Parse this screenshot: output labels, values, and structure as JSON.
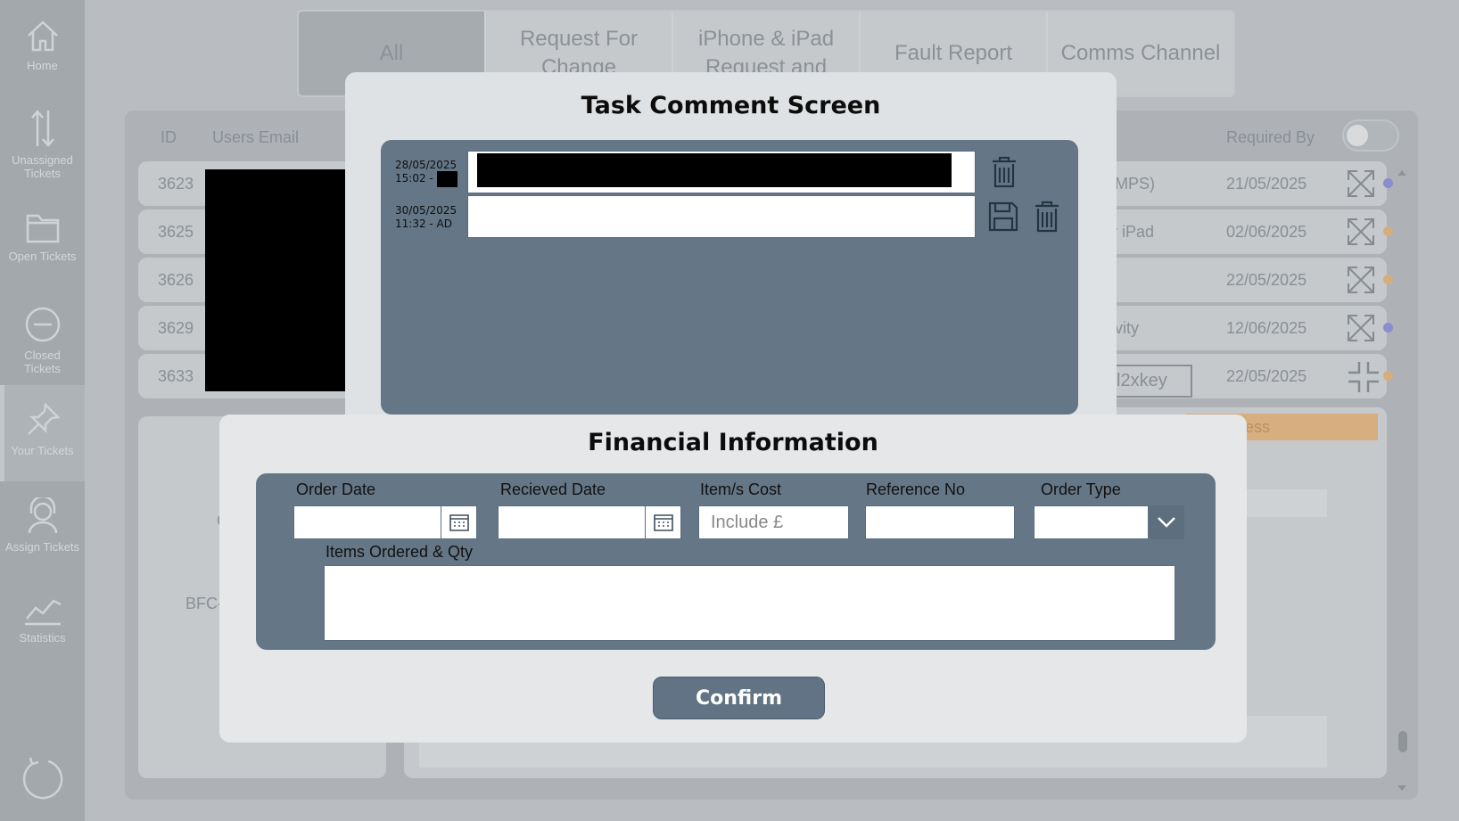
{
  "sidebar": {
    "items": [
      {
        "label": "Home",
        "icon": "home-icon"
      },
      {
        "label": "Unassigned Tickets",
        "icon": "sort-arrows-icon"
      },
      {
        "label": "Open Tickets",
        "icon": "folder-icon"
      },
      {
        "label": "Closed Tickets",
        "icon": "minus-circle-icon"
      },
      {
        "label": "Your Tickets",
        "icon": "pin-icon"
      },
      {
        "label": "Assign Tickets",
        "icon": "headset-icon"
      },
      {
        "label": "Statistics",
        "icon": "chart-line-icon"
      }
    ],
    "active_index": 4
  },
  "tabs": [
    "All",
    "Request For Change",
    "iPhone & iPad Request and",
    "Fault Report",
    "Comms Channel"
  ],
  "table": {
    "headers": {
      "id": "ID",
      "email": "Users Email",
      "required_by": "Required By"
    },
    "rows": [
      {
        "id": "3623",
        "partial": "MPS)",
        "required_by": "21/05/2025",
        "dot": "#8a8dcf"
      },
      {
        "id": "3625",
        "partial": "r iPad",
        "required_by": "02/06/2025",
        "dot": "#d6ad7e"
      },
      {
        "id": "3626",
        "partial": "",
        "required_by": "22/05/2025",
        "dot": "#d6ad7e"
      },
      {
        "id": "3629",
        "partial": "vity",
        "required_by": "12/06/2025",
        "dot": "#8a8dcf"
      },
      {
        "id": "3633",
        "partial": "l2xkey",
        "required_by": "22/05/2025",
        "dot": "#d6ad7e"
      }
    ],
    "progress_label": "ess",
    "bfc_label": "BFC-",
    "c_label": "C"
  },
  "task_modal": {
    "title": "Task Comment Screen",
    "comments": [
      {
        "date": "28/05/2025",
        "time_prefix": "15:02  -",
        "initials": ""
      },
      {
        "date": "30/05/2025",
        "time_prefix": "11:32  -  AD",
        "initials": ""
      }
    ]
  },
  "financial_modal": {
    "title": "Financial Information",
    "fields": {
      "order_date_label": "Order Date",
      "received_date_label": "Recieved Date",
      "cost_label": "Item/s Cost",
      "cost_placeholder": "Include £",
      "reference_label": "Reference No",
      "order_type_label": "Order Type",
      "items_label": "Items Ordered & Qty"
    },
    "confirm_label": "Confirm"
  },
  "colors": {
    "modal_panel": "#657686",
    "confirm_button": "#617384",
    "status_purple": "#8a8dcf",
    "status_orange": "#d6ad7e"
  }
}
